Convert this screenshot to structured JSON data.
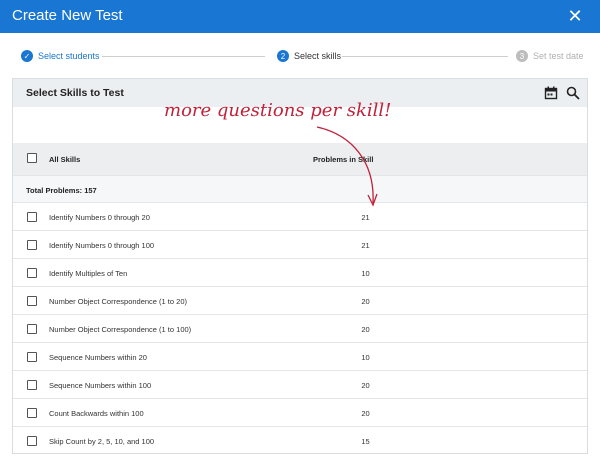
{
  "window": {
    "title": "Create New Test"
  },
  "stepper": {
    "steps": [
      {
        "label": "Select students",
        "state": "complete",
        "marker": "✓"
      },
      {
        "label": "Select skills",
        "state": "current",
        "marker": "2"
      },
      {
        "label": "Set test date",
        "state": "upcoming",
        "marker": "3"
      }
    ]
  },
  "card": {
    "title": "Select Skills to Test",
    "icons": [
      "calendar-icon",
      "search-icon"
    ]
  },
  "annotation": {
    "text": "more questions per skill!",
    "color": "#c0223a"
  },
  "table": {
    "columns": [
      "All Skills",
      "Problems in Skill"
    ],
    "total_label": "Total Problems: 157",
    "rows": [
      {
        "skill": "Identify Numbers 0 through 20",
        "problems": "21"
      },
      {
        "skill": "Identify Numbers 0 through 100",
        "problems": "21"
      },
      {
        "skill": "Identify Multiples of Ten",
        "problems": "10"
      },
      {
        "skill": "Number Object Correspondence (1 to 20)",
        "problems": "20"
      },
      {
        "skill": "Number Object Correspondence (1 to 100)",
        "problems": "20"
      },
      {
        "skill": "Sequence Numbers within 20",
        "problems": "10"
      },
      {
        "skill": "Sequence Numbers within 100",
        "problems": "20"
      },
      {
        "skill": "Count Backwards within 100",
        "problems": "20"
      },
      {
        "skill": "Skip Count by 2, 5, 10, and 100",
        "problems": "15"
      }
    ]
  },
  "colors": {
    "accent": "#1976d2",
    "header_bg": "#eceff1"
  }
}
